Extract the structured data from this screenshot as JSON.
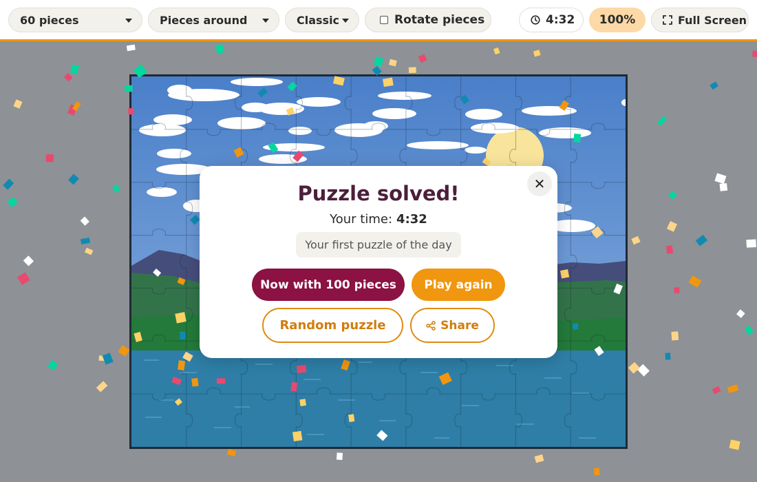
{
  "toolbar": {
    "pieces_select": "60 pieces",
    "shape_select": "Pieces around",
    "style_select": "Classic",
    "rotate_label": "Rotate pieces",
    "rotate_checked": false,
    "timer": "4:32",
    "zoom": "100%",
    "fullscreen_label": "Full Screen",
    "accent_color": "#f0960f"
  },
  "modal": {
    "close_glyph": "✕",
    "title": "Puzzle solved!",
    "time_label": "Your time:",
    "time_value": "4:32",
    "badge": "Your first puzzle of the day",
    "buttons": {
      "more_pieces": "Now with 100 pieces",
      "play_again": "Play again",
      "random": "Random puzzle",
      "share": "Share"
    },
    "colors": {
      "title": "#4b1f3a",
      "primary": "#8b1242",
      "secondary": "#f0960f"
    }
  },
  "icons": {
    "timer": "clock-icon",
    "fullscreen": "fullscreen-icon",
    "share": "share-icon",
    "close": "close-icon",
    "caret": "chevron-down-icon"
  }
}
